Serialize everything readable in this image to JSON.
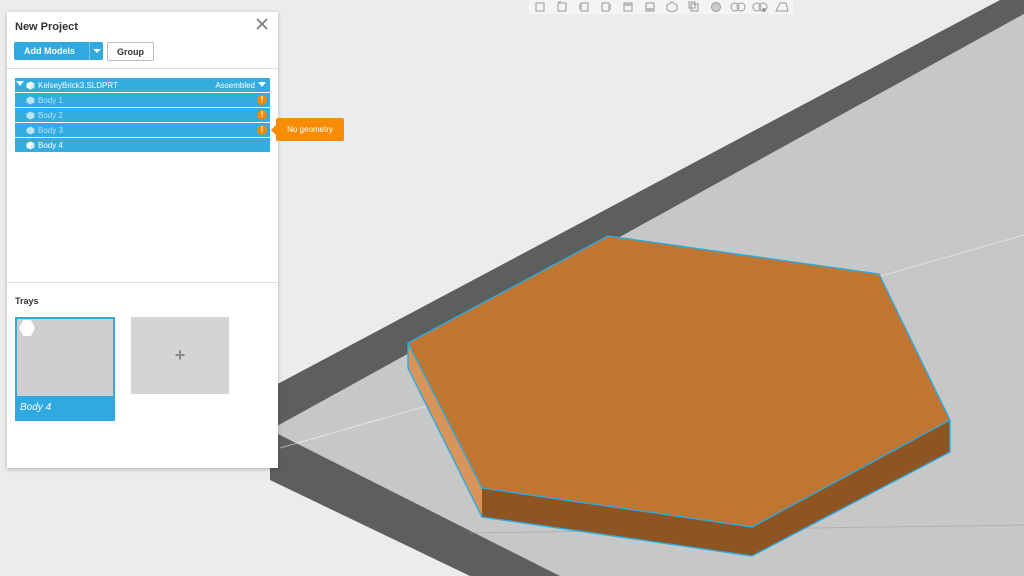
{
  "panel": {
    "title": "New Project",
    "add_models_label": "Add Models",
    "group_label": "Group"
  },
  "tree": {
    "model": {
      "name": "KelseyBrick3.SLDPRT",
      "status": "Assembled"
    },
    "bodies": [
      {
        "name": "Body 1",
        "warning": true
      },
      {
        "name": "Body 2",
        "warning": true
      },
      {
        "name": "Body 3",
        "warning": true
      },
      {
        "name": "Body 4",
        "warning": false
      }
    ]
  },
  "tooltip": "No geometry",
  "trays": {
    "title": "Trays",
    "items": [
      {
        "label": "Body 4"
      }
    ],
    "add_symbol": "+"
  },
  "toolbar": {
    "icons": [
      "view-front-icon",
      "view-back-icon",
      "view-left-icon",
      "view-right-icon",
      "view-top-icon",
      "view-bottom-icon",
      "view-iso-icon",
      "view-fit-icon",
      "render-mode-icon",
      "visibility-icon",
      "camera-icon",
      "perspective-icon"
    ]
  },
  "colors": {
    "accent": "#2fa9e0",
    "warning": "#f08a00",
    "part_top": "#c07530",
    "part_side": "#8e5421",
    "part_left": "#d9945a",
    "outline": "#2fa9e0",
    "tray_bg": "#c8c8c8",
    "wall_dark": "#5d5f5f"
  }
}
